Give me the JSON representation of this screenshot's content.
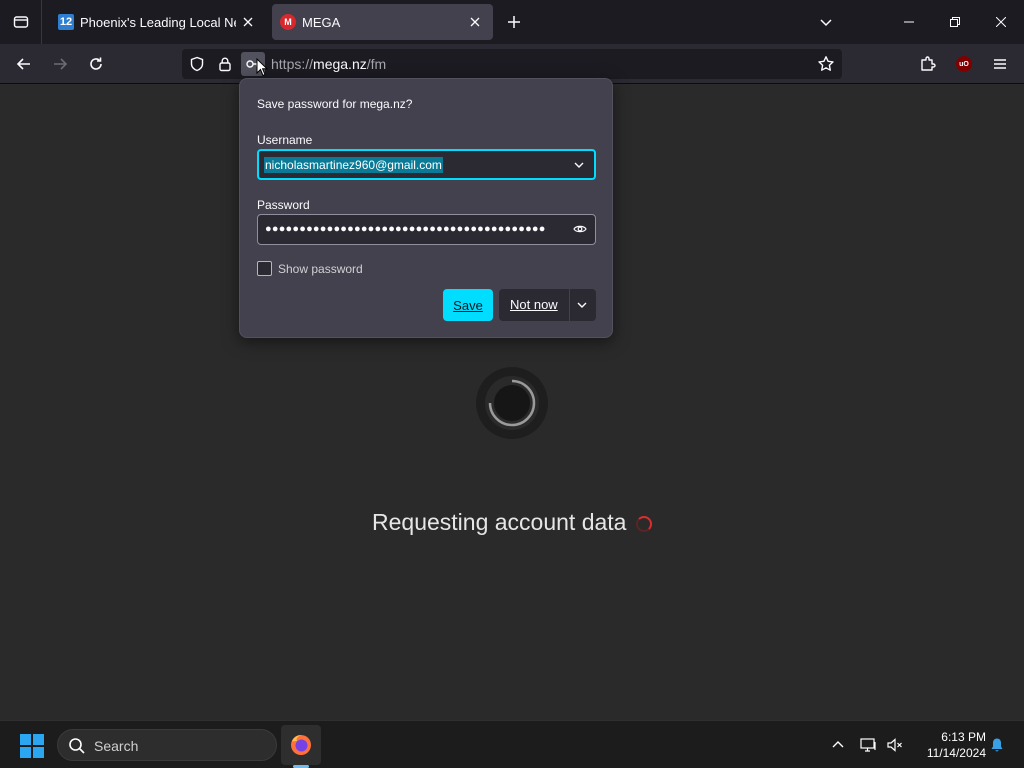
{
  "browser": {
    "tabs": [
      {
        "title": "Phoenix's Leading Local News:",
        "favicon": "12-news-favicon"
      },
      {
        "title": "MEGA",
        "favicon": "mega-favicon"
      }
    ],
    "url": {
      "scheme": "https://",
      "host": "mega.nz",
      "path": "/fm"
    }
  },
  "password_popup": {
    "header": "Save password for mega.nz?",
    "username_label": "Username",
    "username_value": "nicholasmartinez960@gmail.com",
    "password_label": "Password",
    "password_value": "●●●●●●●●●●●●●●●●●●●●●●●●●●●●●●●●●●●●●●●●●",
    "show_password_label": "Show password",
    "save_label": "Save",
    "not_now_label": "Not now"
  },
  "page": {
    "status_text": "Requesting account data"
  },
  "taskbar": {
    "search_label": "Search",
    "time": "6:13 PM",
    "date": "11/14/2024"
  },
  "colors": {
    "accent": "#00ddff",
    "mega_red": "#d9272e",
    "page_background": "#2b2a2a"
  }
}
